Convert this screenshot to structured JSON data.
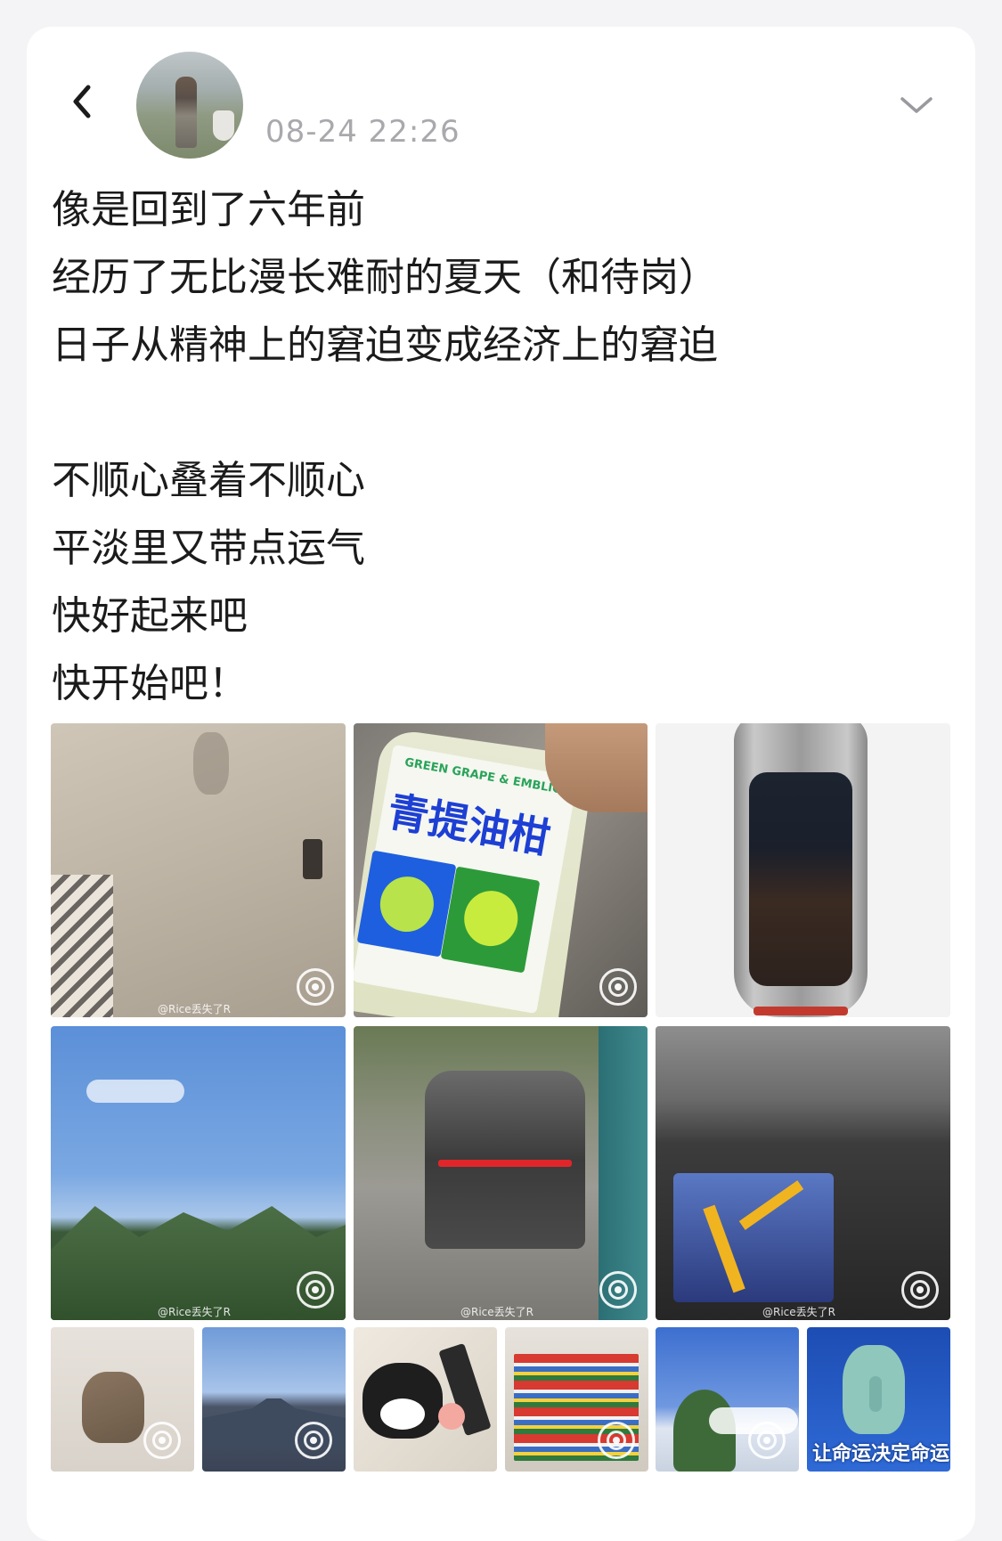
{
  "header": {
    "timestamp": "08-24 22:26",
    "back_icon": "chevron-left-icon",
    "menu_icon": "chevron-down-icon"
  },
  "post": {
    "lines": [
      "像是回到了六年前",
      "经历了无比漫长难耐的夏天（和待岗）",
      "日子从精神上的窘迫变成经济上的窘迫",
      "",
      "不顺心叠着不顺心",
      "平淡里又带点运气",
      "快好起来吧",
      "快开始吧！"
    ]
  },
  "media": {
    "watermark": "@Rice丢失了R",
    "bottle_title": "青提油柑",
    "bottle_subtitle": "GREEN GRAPE & EMBLIC",
    "meme_caption": "让命运决定命运",
    "play_icon": "live-photo-icon"
  },
  "colors": {
    "text": "#1b1b1b",
    "timestamp": "#a9a9ad",
    "background": "#f4f4f6",
    "card": "#ffffff"
  }
}
